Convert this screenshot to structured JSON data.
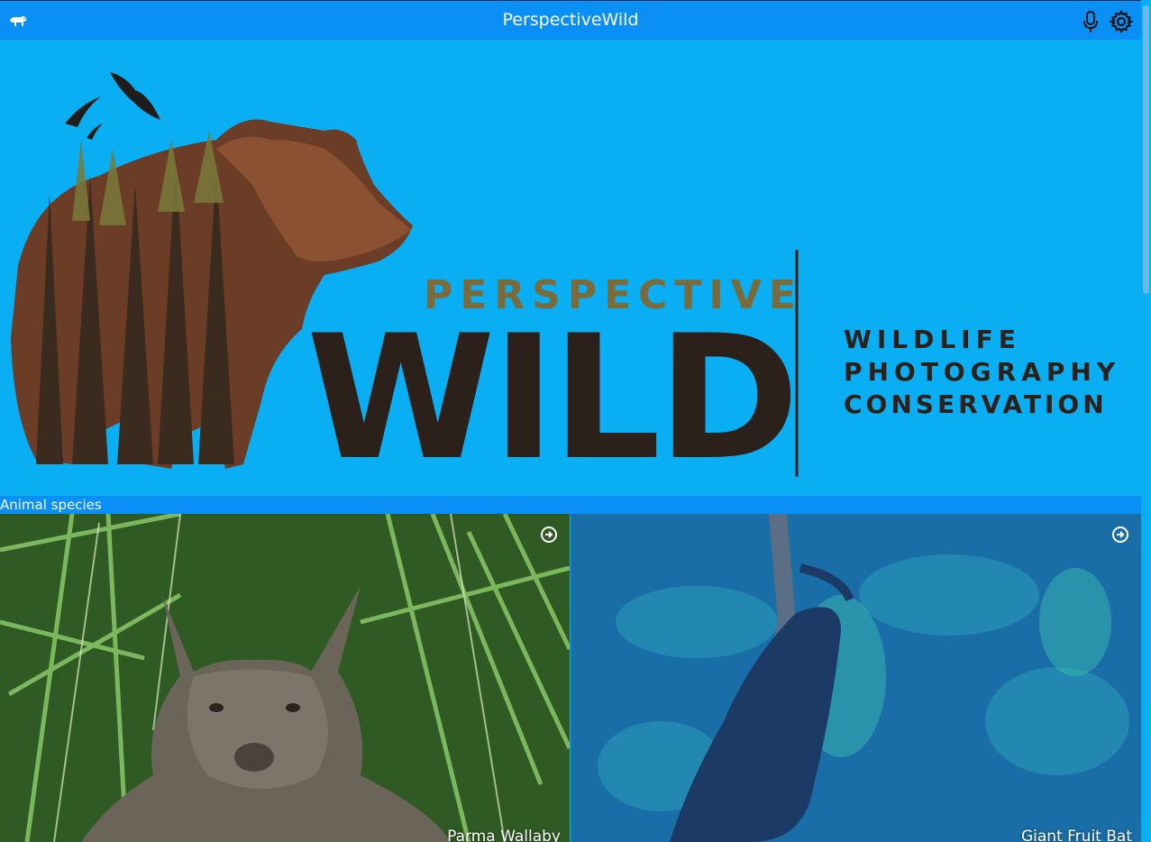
{
  "app": {
    "title": "PerspectiveWild",
    "icons": {
      "logo": "polar-bear-icon",
      "mic": "microphone-icon",
      "settings": "gear-icon"
    }
  },
  "banner": {
    "wordmark_top": "PERSPECTIVE",
    "wordmark_main": "WILD",
    "taglines": [
      "WILDLIFE",
      "PHOTOGRAPHY",
      "CONSERVATION"
    ]
  },
  "section": {
    "title": "Animal species"
  },
  "species": [
    {
      "name": "Parma Wallaby"
    },
    {
      "name": "Giant Fruit Bat"
    }
  ],
  "colors": {
    "topbar": "#0a8ff5",
    "background": "#0aaef2",
    "wordmark_dark": "#2b211a",
    "wordmark_olive": "#7b6a3a"
  }
}
